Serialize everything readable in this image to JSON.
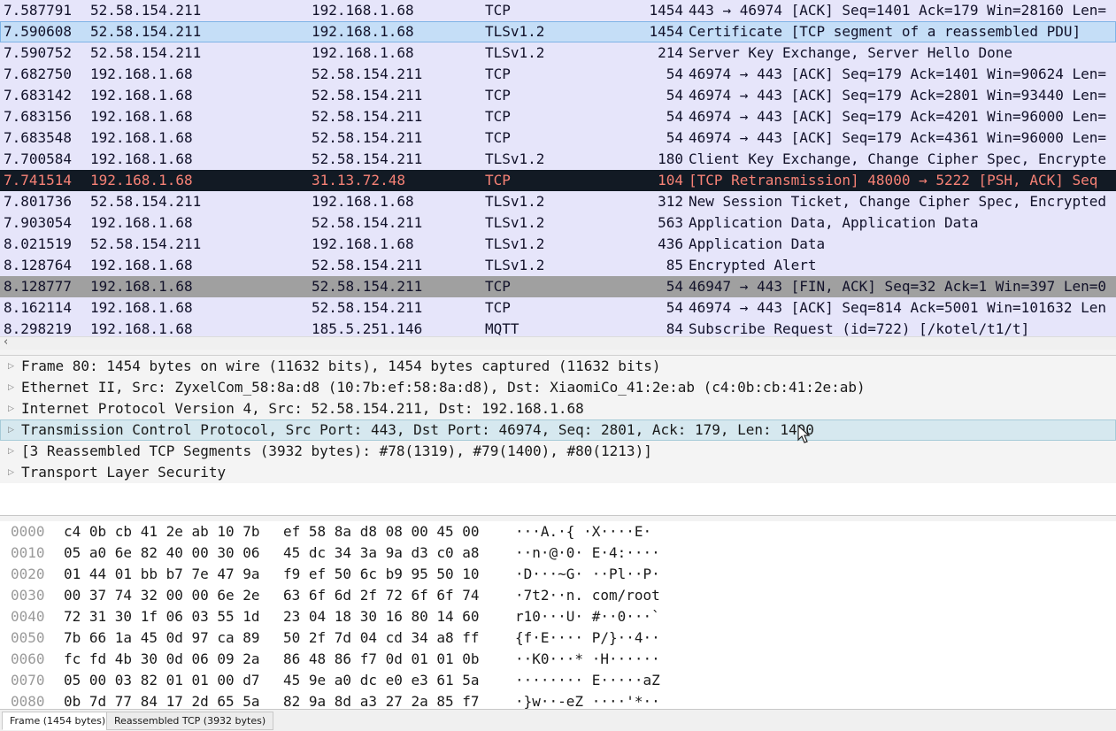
{
  "packets": [
    {
      "time": "7.587791",
      "src": "52.58.154.211",
      "dst": "192.168.1.68",
      "proto": "TCP",
      "len": "1454",
      "info": "443 → 46974 [ACK] Seq=1401 Ack=179 Win=28160 Len=",
      "style": "normal"
    },
    {
      "time": "7.590608",
      "src": "52.58.154.211",
      "dst": "192.168.1.68",
      "proto": "TLSv1.2",
      "len": "1454",
      "info": "Certificate [TCP segment of a reassembled PDU]",
      "style": "selected"
    },
    {
      "time": "7.590752",
      "src": "52.58.154.211",
      "dst": "192.168.1.68",
      "proto": "TLSv1.2",
      "len": "214",
      "info": "Server Key Exchange, Server Hello Done",
      "style": "normal"
    },
    {
      "time": "7.682750",
      "src": "192.168.1.68",
      "dst": "52.58.154.211",
      "proto": "TCP",
      "len": "54",
      "info": "46974 → 443 [ACK] Seq=179 Ack=1401 Win=90624 Len=",
      "style": "normal"
    },
    {
      "time": "7.683142",
      "src": "192.168.1.68",
      "dst": "52.58.154.211",
      "proto": "TCP",
      "len": "54",
      "info": "46974 → 443 [ACK] Seq=179 Ack=2801 Win=93440 Len=",
      "style": "normal"
    },
    {
      "time": "7.683156",
      "src": "192.168.1.68",
      "dst": "52.58.154.211",
      "proto": "TCP",
      "len": "54",
      "info": "46974 → 443 [ACK] Seq=179 Ack=4201 Win=96000 Len=",
      "style": "normal"
    },
    {
      "time": "7.683548",
      "src": "192.168.1.68",
      "dst": "52.58.154.211",
      "proto": "TCP",
      "len": "54",
      "info": "46974 → 443 [ACK] Seq=179 Ack=4361 Win=96000 Len=",
      "style": "normal"
    },
    {
      "time": "7.700584",
      "src": "192.168.1.68",
      "dst": "52.58.154.211",
      "proto": "TLSv1.2",
      "len": "180",
      "info": "Client Key Exchange, Change Cipher Spec, Encrypte",
      "style": "normal"
    },
    {
      "time": "7.741514",
      "src": "192.168.1.68",
      "dst": "31.13.72.48",
      "proto": "TCP",
      "len": "104",
      "info": "[TCP Retransmission] 48000 → 5222 [PSH, ACK] Seq",
      "style": "dark"
    },
    {
      "time": "7.801736",
      "src": "52.58.154.211",
      "dst": "192.168.1.68",
      "proto": "TLSv1.2",
      "len": "312",
      "info": "New Session Ticket, Change Cipher Spec, Encrypted",
      "style": "normal"
    },
    {
      "time": "7.903054",
      "src": "192.168.1.68",
      "dst": "52.58.154.211",
      "proto": "TLSv1.2",
      "len": "563",
      "info": "Application Data, Application Data",
      "style": "normal"
    },
    {
      "time": "8.021519",
      "src": "52.58.154.211",
      "dst": "192.168.1.68",
      "proto": "TLSv1.2",
      "len": "436",
      "info": "Application Data",
      "style": "normal"
    },
    {
      "time": "8.128764",
      "src": "192.168.1.68",
      "dst": "52.58.154.211",
      "proto": "TLSv1.2",
      "len": "85",
      "info": "Encrypted Alert",
      "style": "normal"
    },
    {
      "time": "8.128777",
      "src": "192.168.1.68",
      "dst": "52.58.154.211",
      "proto": "TCP",
      "len": "54",
      "info": "46947 → 443 [FIN, ACK] Seq=32 Ack=1 Win=397 Len=0",
      "style": "gray"
    },
    {
      "time": "8.162114",
      "src": "192.168.1.68",
      "dst": "52.58.154.211",
      "proto": "TCP",
      "len": "54",
      "info": "46974 → 443 [ACK] Seq=814 Ack=5001 Win=101632 Len",
      "style": "normal"
    },
    {
      "time": "8.298219",
      "src": "192.168.1.68",
      "dst": "185.5.251.146",
      "proto": "MQTT",
      "len": "84",
      "info": "Subscribe Request (id=722) [/kotel/t1/t]",
      "style": "normal"
    }
  ],
  "details": [
    {
      "text": "Frame 80: 1454 bytes on wire (11632 bits), 1454 bytes captured (11632 bits)",
      "selected": false
    },
    {
      "text": "Ethernet II, Src: ZyxelCom_58:8a:d8 (10:7b:ef:58:8a:d8), Dst: XiaomiCo_41:2e:ab (c4:0b:cb:41:2e:ab)",
      "selected": false
    },
    {
      "text": "Internet Protocol Version 4, Src: 52.58.154.211, Dst: 192.168.1.68",
      "selected": false
    },
    {
      "text": "Transmission Control Protocol, Src Port: 443, Dst Port: 46974, Seq: 2801, Ack: 179, Len: 1400",
      "selected": true
    },
    {
      "text": "[3 Reassembled TCP Segments (3932 bytes): #78(1319), #79(1400), #80(1213)]",
      "selected": false
    },
    {
      "text": "Transport Layer Security",
      "selected": false
    }
  ],
  "hex": [
    {
      "offset": "0000",
      "b1": "c4 0b cb 41 2e ab 10 7b",
      "b2": "ef 58 8a d8 08 00 45 00",
      "ascii": "···A.·{ ·X····E·"
    },
    {
      "offset": "0010",
      "b1": "05 a0 6e 82 40 00 30 06",
      "b2": "45 dc 34 3a 9a d3 c0 a8",
      "ascii": "··n·@·0· E·4:····"
    },
    {
      "offset": "0020",
      "b1": "01 44 01 bb b7 7e 47 9a",
      "b2": "f9 ef 50 6c b9 95 50 10",
      "ascii": "·D···~G· ··Pl··P·"
    },
    {
      "offset": "0030",
      "b1": "00 37 74 32 00 00 6e 2e",
      "b2": "63 6f 6d 2f 72 6f 6f 74",
      "ascii": "·7t2··n. com/root"
    },
    {
      "offset": "0040",
      "b1": "72 31 30 1f 06 03 55 1d",
      "b2": "23 04 18 30 16 80 14 60",
      "ascii": "r10···U· #··0···`"
    },
    {
      "offset": "0050",
      "b1": "7b 66 1a 45 0d 97 ca 89",
      "b2": "50 2f 7d 04 cd 34 a8 ff",
      "ascii": "{f·E···· P/}··4··"
    },
    {
      "offset": "0060",
      "b1": "fc fd 4b 30 0d 06 09 2a",
      "b2": "86 48 86 f7 0d 01 01 0b",
      "ascii": "··K0···* ·H······"
    },
    {
      "offset": "0070",
      "b1": "05 00 03 82 01 01 00 d7",
      "b2": "45 9e a0 dc e0 e3 61 5a",
      "ascii": "········ E·····aZ"
    },
    {
      "offset": "0080",
      "b1": "0b 7d 77 84 17 2d 65 5a",
      "b2": "82 9a 8d a3 27 2a 85 f7",
      "ascii": "·}w··-eZ ····'*··"
    }
  ],
  "tabs": {
    "frame": "Frame (1454 bytes)",
    "reassembled": "Reassembled TCP (3932 bytes)"
  },
  "icons": {
    "scroll_left": "chevron-left-icon",
    "tree_expand": "triangle-right-icon",
    "pointer": "mouse-pointer-icon"
  }
}
